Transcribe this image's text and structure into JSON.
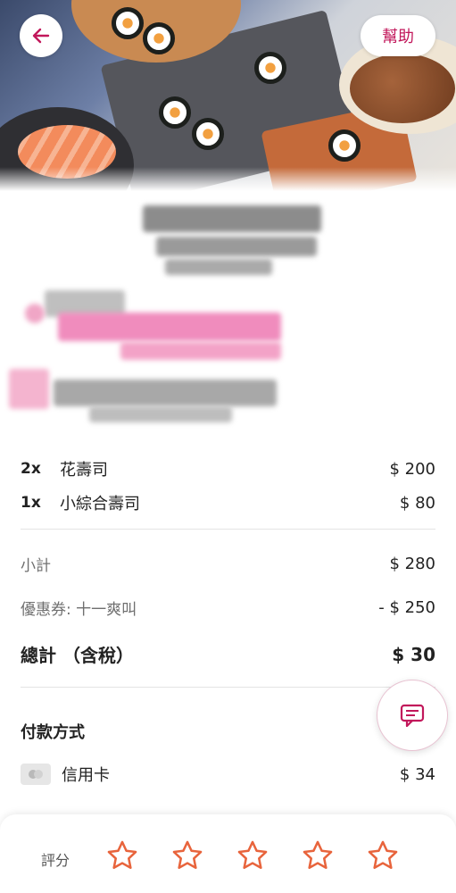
{
  "header": {
    "help_label": "幫助"
  },
  "order": {
    "items": [
      {
        "qty": "2x",
        "name": "花壽司",
        "price": "$ 200"
      },
      {
        "qty": "1x",
        "name": "小綜合壽司",
        "price": "$ 80"
      }
    ]
  },
  "summary": {
    "subtotal_label": "小計",
    "subtotal_value": "$ 280",
    "coupon_label": "優惠券: 十一爽叫",
    "coupon_value": "- $ 250",
    "total_label": "總計 （含稅）",
    "total_value": "$ 30"
  },
  "payment": {
    "title": "付款方式",
    "method_label": "信用卡",
    "method_value": "$ 34"
  },
  "rating": {
    "label": "評分",
    "stars_count": 5
  },
  "colors": {
    "brand": "#c2185b",
    "star": "#e8643c"
  }
}
